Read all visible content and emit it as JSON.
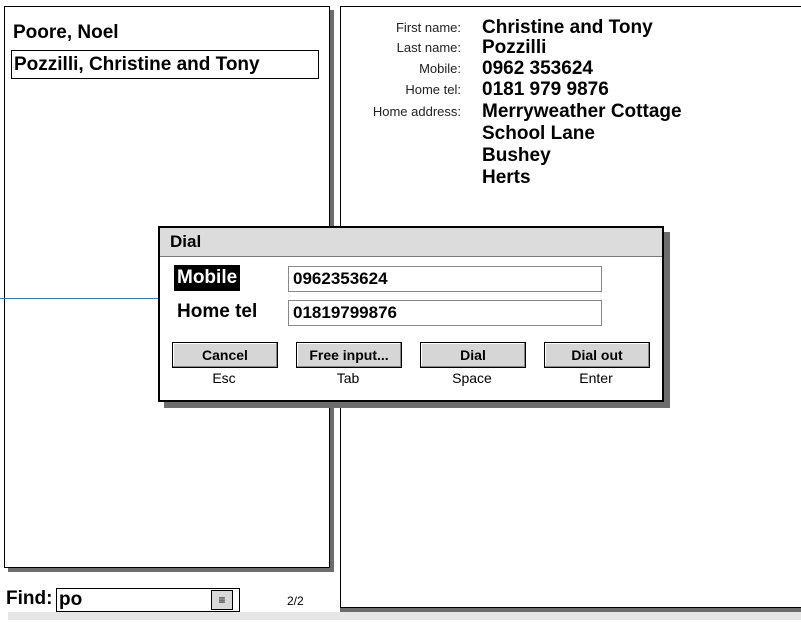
{
  "contacts": [
    {
      "name": "Poore, Noel"
    },
    {
      "name": "Pozzilli, Christine and Tony"
    }
  ],
  "details": {
    "first_name_label": "First name:",
    "first_name": "Christine and Tony",
    "last_name_label": "Last name:",
    "last_name": "Pozzilli",
    "mobile_label": "Mobile:",
    "mobile": "0962 353624",
    "home_tel_label": "Home tel:",
    "home_tel": "0181 979 9876",
    "home_address_label": "Home address:",
    "address": [
      "Merryweather Cottage",
      "School Lane",
      "Bushey",
      "Herts"
    ]
  },
  "find": {
    "label": "Find:",
    "value": "po",
    "count": "2/2",
    "icon": "list-icon"
  },
  "dialog": {
    "title": "Dial",
    "mobile_label": "Mobile",
    "mobile_value": "0962353624",
    "home_tel_label": "Home tel",
    "home_tel_value": "01819799876",
    "buttons": [
      {
        "label": "Cancel",
        "key": "Esc"
      },
      {
        "label": "Free input...",
        "key": "Tab"
      },
      {
        "label": "Dial",
        "key": "Space"
      },
      {
        "label": "Dial out",
        "key": "Enter"
      }
    ]
  },
  "colors": {
    "callout_line": "#3a7cb8",
    "shadow": "#6d6d6d",
    "button_face": "#d6d6d6"
  }
}
